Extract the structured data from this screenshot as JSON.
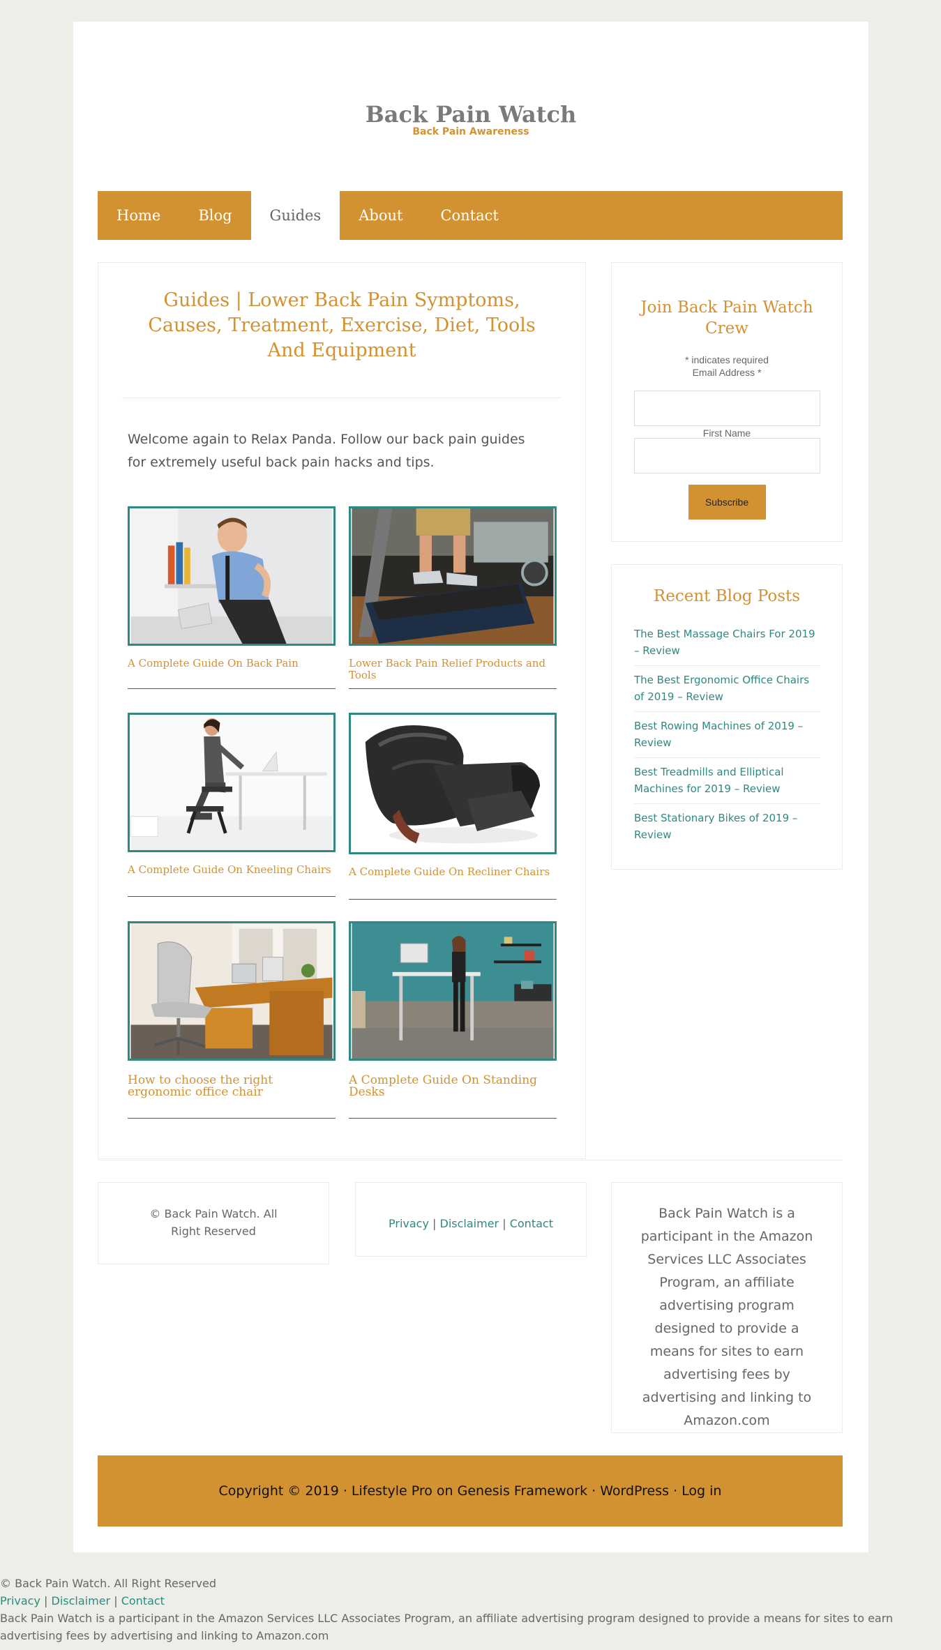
{
  "header": {
    "site_title": "Back Pain Watch",
    "site_description": "Back Pain Awareness"
  },
  "nav": {
    "items": [
      {
        "label": "Home"
      },
      {
        "label": "Blog"
      },
      {
        "label": "Guides"
      },
      {
        "label": "About"
      },
      {
        "label": "Contact"
      }
    ],
    "active": "Guides"
  },
  "main": {
    "title": "Guides | Lower Back Pain Symptoms, Causes, Treatment, Exercise, Diet, Tools And Equipment",
    "intro": "Welcome again to Relax Panda. Follow our back pain guides for extremely useful back pain hacks and tips.",
    "guides": [
      {
        "title": "A Complete Guide On Back Pain",
        "image": "man-holding-back"
      },
      {
        "title": "Lower Back Pain Relief Products and Tools",
        "image": "treadmill"
      },
      {
        "title": "A Complete Guide On Kneeling Chairs",
        "image": "kneeling-chair"
      },
      {
        "title": "A Complete Guide On Recliner Chairs",
        "image": "recliner-chair"
      },
      {
        "title": "How to choose the right ergonomic office chair",
        "image": "office-chair"
      },
      {
        "title": "A Complete Guide On Standing Desks",
        "image": "standing-desk"
      }
    ]
  },
  "sidebar": {
    "newsletter": {
      "title": "Join Back Pain Watch Crew",
      "required_note": "* indicates required",
      "email_label": "Email Address *",
      "first_name_label": "First Name",
      "subscribe_label": "Subscribe"
    },
    "recent_posts": {
      "title": "Recent Blog Posts",
      "posts": [
        "The Best Massage Chairs For 2019 – Review",
        "The Best Ergonomic Office Chairs of 2019 – Review",
        "Best Rowing Machines of 2019 – Review",
        "Best Treadmills and Elliptical Machines for 2019 – Review",
        "Best Stationary Bikes of 2019 – Review"
      ]
    }
  },
  "footer": {
    "rights": "© Back Pain Watch. All Right Reserved",
    "links": [
      "Privacy",
      "Disclaimer",
      "Contact"
    ],
    "separator": "|",
    "affiliate": "Back Pain Watch is a participant in the Amazon Services LLC Associates Program, an affiliate advertising program designed to provide a means for sites to earn advertising fees by advertising and linking to Amazon.com",
    "copyright": {
      "prefix": "Copyright © 2019 · ",
      "theme": "Lifestyle Pro on Genesis Framework",
      "dot": " · ",
      "wordpress": "WordPress",
      "login": "Log in"
    }
  },
  "colors": {
    "accent": "#d39232",
    "link": "#2e8a80",
    "background": "#eeeee8"
  }
}
